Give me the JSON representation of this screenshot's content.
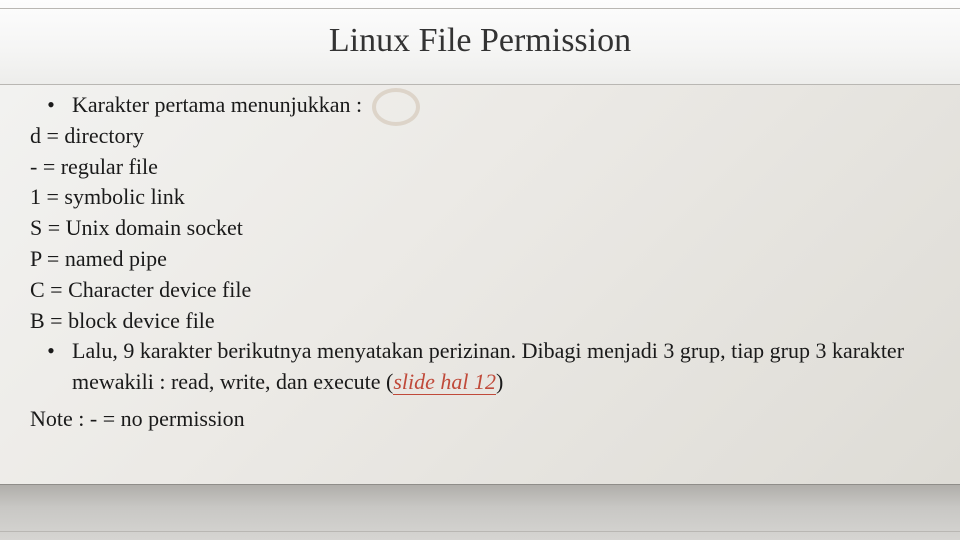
{
  "title": "Linux File Permission",
  "bullet1": "Karakter pertama menunjukkan :",
  "lines": {
    "d": "d = directory",
    "dash": "-   = regular file",
    "one": "1 = symbolic link",
    "s": "S = Unix domain socket",
    "p": "P = named pipe",
    "c": "C = Character device file",
    "b": "B = block device file"
  },
  "bullet2_part1": "Lalu, 9 karakter berikutnya menyatakan perizinan. Dibagi menjadi 3 grup, tiap grup 3 karakter mewakili : read, write, dan execute (",
  "slidelink": "slide hal 12",
  "bullet2_part2": ")",
  "note": "Note : - = no permission",
  "bullet_glyph": "•"
}
